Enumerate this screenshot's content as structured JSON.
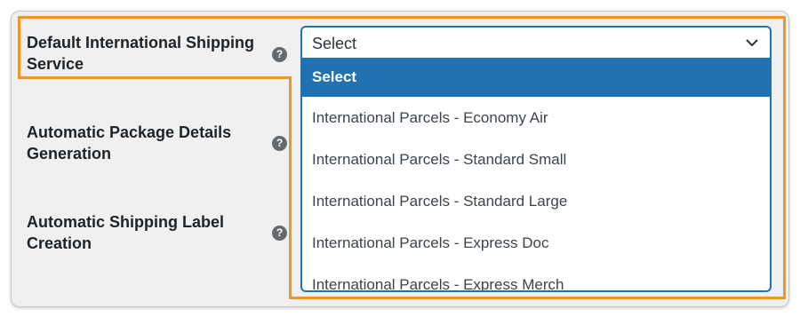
{
  "settings": {
    "rows": [
      {
        "label": "Default International Shipping Service",
        "help_icon": "question-circle-icon"
      },
      {
        "label": "Automatic Package Details Generation",
        "help_icon": "question-circle-icon"
      },
      {
        "label": "Automatic Shipping Label Creation",
        "help_icon": "question-circle-icon"
      }
    ],
    "help_glyph": "?"
  },
  "select": {
    "value": "Select",
    "icon": "chevron-down-icon"
  },
  "dropdown": {
    "options": [
      "Select",
      "International Parcels - Economy Air",
      "International Parcels - Standard Small",
      "International Parcels - Standard Large",
      "International Parcels - Express Doc",
      "International Parcels - Express Merch"
    ],
    "selected_index": 0
  },
  "colors": {
    "highlight": "#f0952a",
    "accent": "#2271b1",
    "background": "#f0f0f1"
  }
}
